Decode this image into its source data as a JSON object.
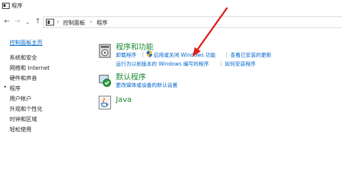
{
  "window": {
    "title": "程序"
  },
  "nav": {
    "back": "←",
    "forward": "→",
    "recent": "⌄",
    "up": "↑"
  },
  "breadcrumb": {
    "items": [
      "控制面板",
      "程序"
    ],
    "separator": "›"
  },
  "sidebar": {
    "home_link": "控制面板主页",
    "items": [
      {
        "label": "系统和安全",
        "active": false
      },
      {
        "label": "网络和 Internet",
        "active": false
      },
      {
        "label": "硬件和声音",
        "active": false
      },
      {
        "label": "程序",
        "active": true
      },
      {
        "label": "用户帐户",
        "active": false
      },
      {
        "label": "外观和个性化",
        "active": false
      },
      {
        "label": "时钟和区域",
        "active": false
      },
      {
        "label": "轻松使用",
        "active": false
      }
    ],
    "active_marker": "•"
  },
  "categories": {
    "programs_features": {
      "title": "程序和功能",
      "icon": "programs-features-icon",
      "links": [
        "卸载程序",
        "启用或关闭 Windows 功能",
        "查看已安装的更新",
        "运行为以前版本的 Windows 编写的程序",
        "如何安装程序"
      ]
    },
    "default_programs": {
      "title": "默认程序",
      "icon": "default-programs-icon",
      "links": [
        "更改媒体或设备的默认设置"
      ]
    },
    "java": {
      "title": "Java",
      "icon": "java-icon"
    }
  },
  "colors": {
    "link": "#0066cc",
    "category_title": "#1e8a32",
    "annotation_arrow": "#e02020"
  }
}
